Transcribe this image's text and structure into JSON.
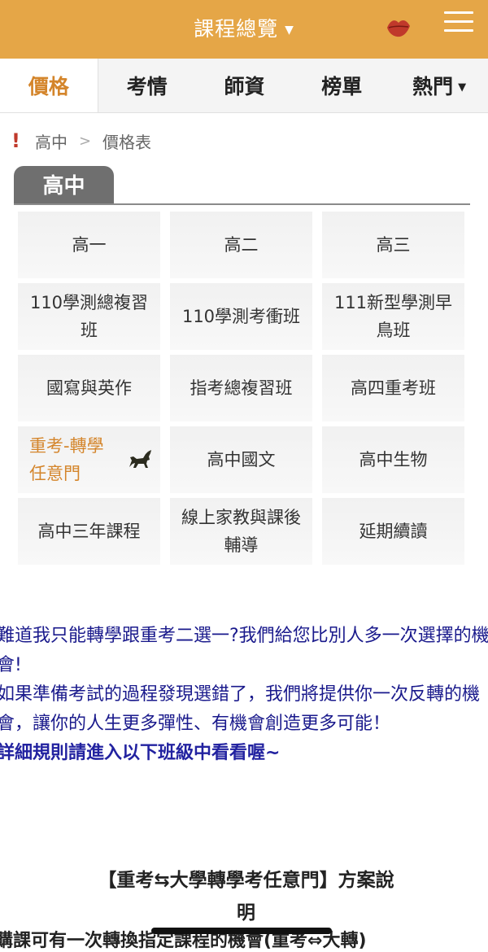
{
  "header": {
    "title": "課程總覽",
    "colors": {
      "bar": "#e5a647",
      "accent": "#d4852b"
    },
    "icons": [
      "chevron-down-icon",
      "lips-icon",
      "hamburger-menu-icon"
    ]
  },
  "tabs": [
    {
      "label": "價格",
      "active": true
    },
    {
      "label": "考情"
    },
    {
      "label": "師資"
    },
    {
      "label": "榜單"
    },
    {
      "label": "熱門"
    }
  ],
  "breadcrumb": {
    "level1": "高中",
    "separator": ">",
    "level2": "價格表"
  },
  "section": {
    "title": "高中"
  },
  "grid": [
    {
      "label": "高一"
    },
    {
      "label": "高二"
    },
    {
      "label": "高三"
    },
    {
      "label": "110學測總複習班"
    },
    {
      "label": "110學測考衝班"
    },
    {
      "label": "111新型學測早鳥班"
    },
    {
      "label": "國寫與英作"
    },
    {
      "label": "指考總複習班"
    },
    {
      "label": "高四重考班"
    },
    {
      "label": "重考-轉學任意門",
      "highlight": true,
      "icon": "horse-icon"
    },
    {
      "label": "高中國文"
    },
    {
      "label": "高中生物"
    },
    {
      "label": "高中三年課程"
    },
    {
      "label": "線上家教與課後輔導"
    },
    {
      "label": "延期續讀"
    }
  ],
  "notice": {
    "line1": "難道我只能轉學跟重考二選一?我們給您比別人多一次選擇的機會!",
    "line2": "如果準備考試的過程發現選錯了，我們將提供你一次反轉的機會，讓你的人生更多彈性、有機會創造更多可能！",
    "line3": "詳細規則請進入以下班級中看看喔~"
  },
  "plan": {
    "title_line1": "【重考⇆大學轉學考任意門】方案說",
    "title_line2": "明",
    "body_partial": "購課可有一次轉換指定課程的機會(重考⇔大轉)"
  }
}
